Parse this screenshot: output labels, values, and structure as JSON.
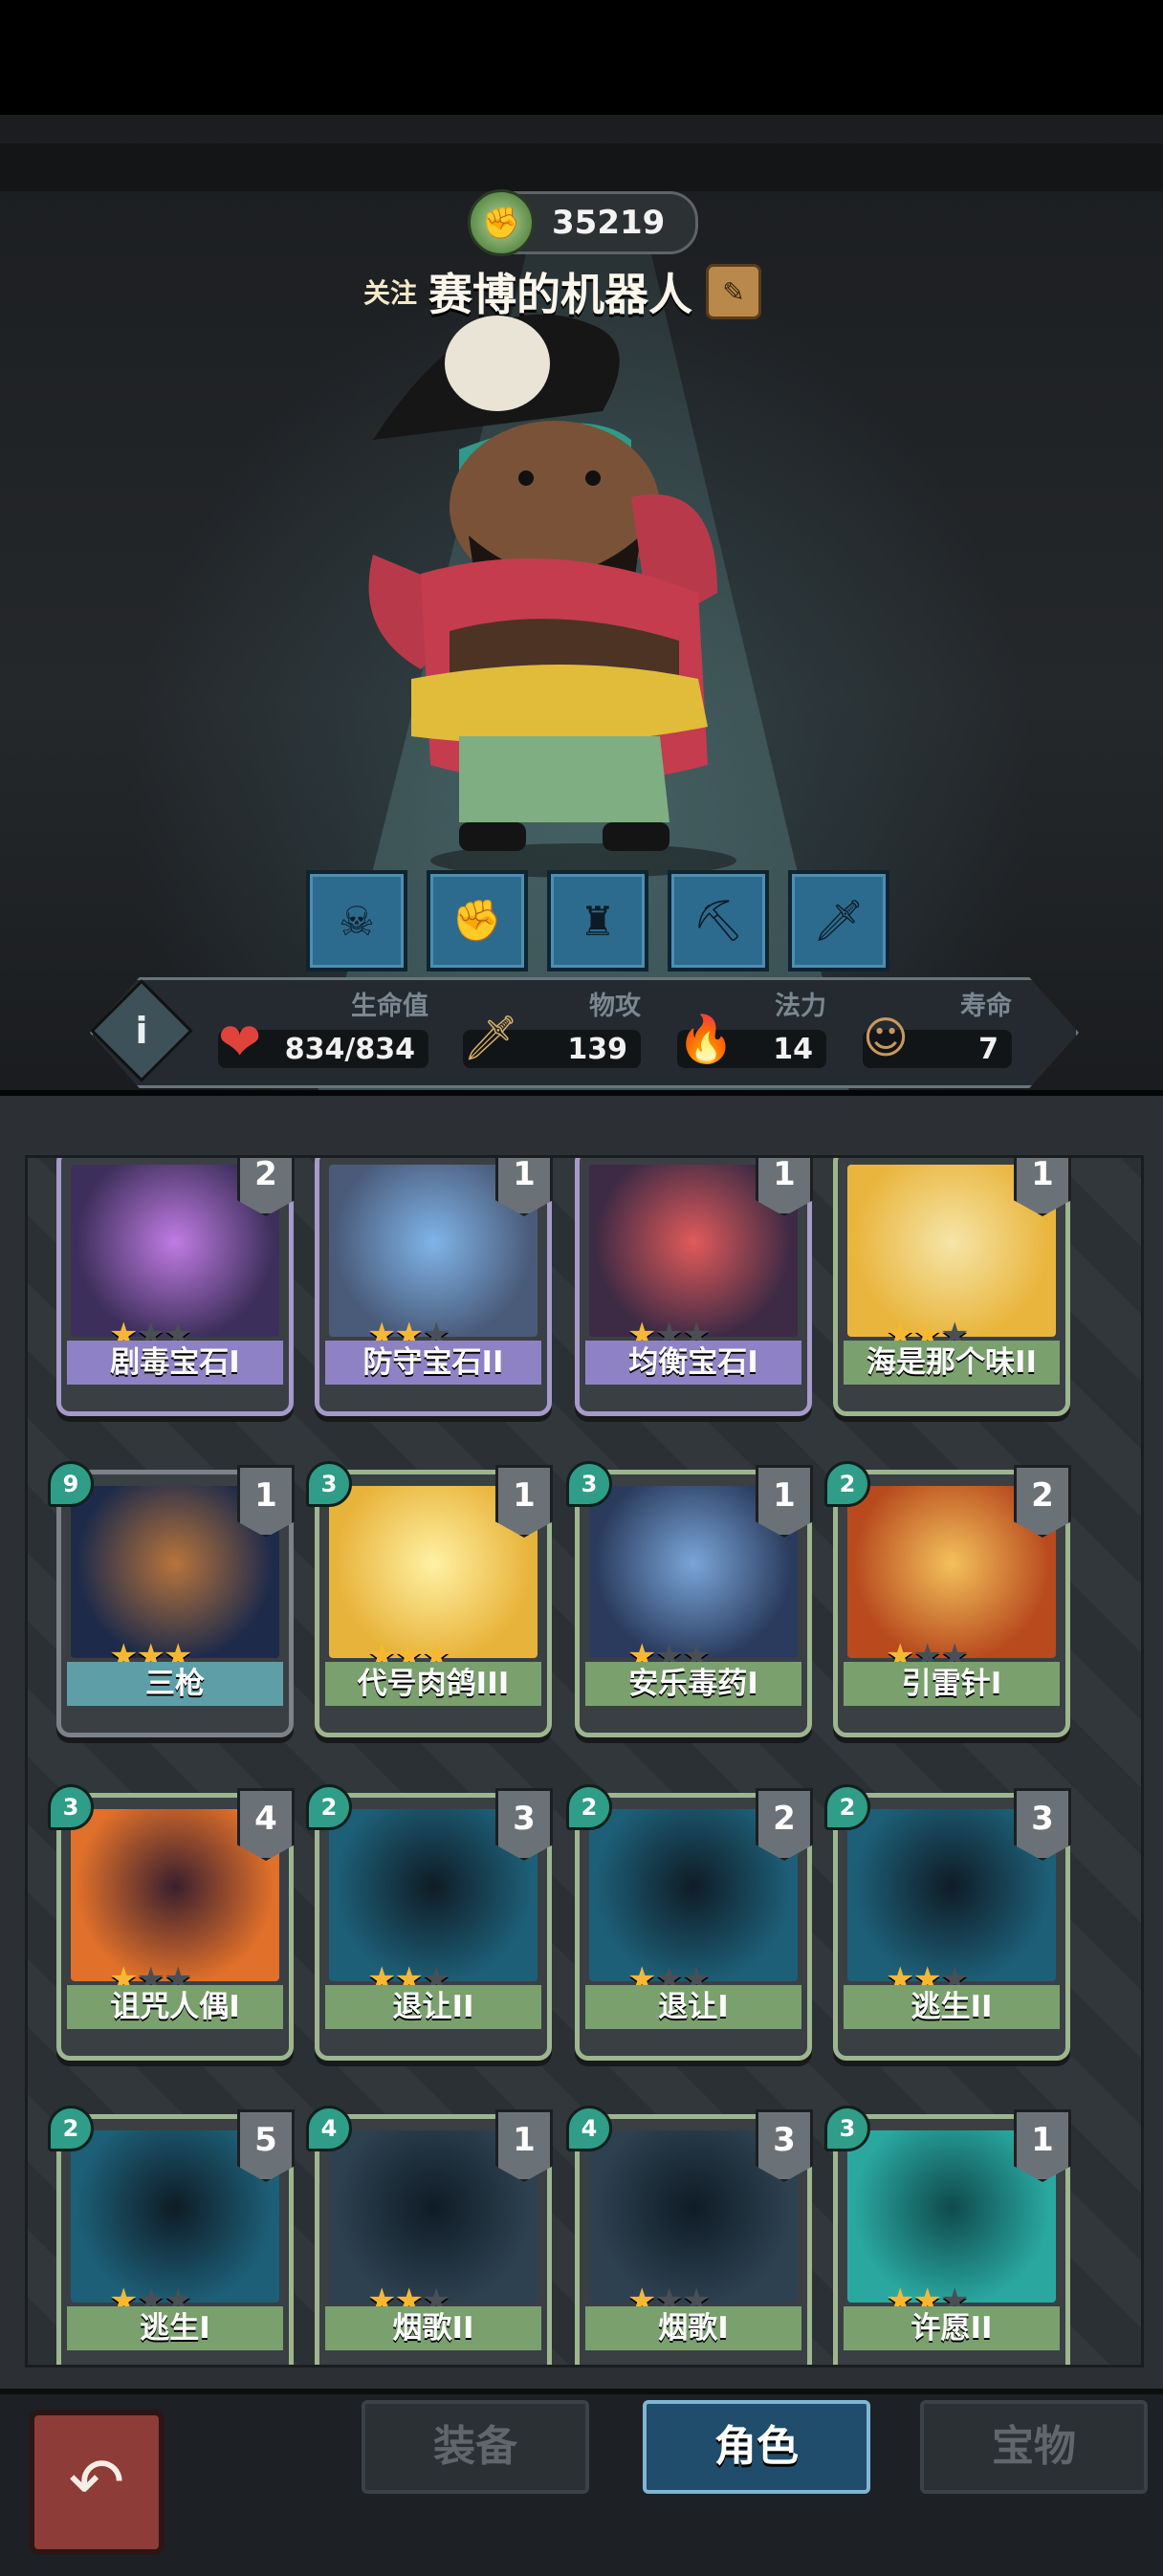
{
  "header": {
    "rating": "35219",
    "follow_label": "关注",
    "hero_name": "赛博的机器人"
  },
  "skills": [
    "bird-skull-icon",
    "fist-icon",
    "tower-icon",
    "pickaxe-icon",
    "dagger-icon"
  ],
  "stats": {
    "hp": {
      "label": "生命值",
      "value": "834/834"
    },
    "attack": {
      "label": "物攻",
      "value": "139"
    },
    "mana": {
      "label": "法力",
      "value": "14"
    },
    "lifespan": {
      "label": "寿命",
      "value": "7"
    }
  },
  "cards": [
    {
      "name": "剧毒宝石I",
      "stars": 1,
      "rarity": "rare",
      "cost": "",
      "count": "2"
    },
    {
      "name": "防守宝石II",
      "stars": 2,
      "rarity": "rare",
      "cost": "",
      "count": "1"
    },
    {
      "name": "均衡宝石I",
      "stars": 1,
      "rarity": "rare",
      "cost": "",
      "count": "1"
    },
    {
      "name": "海是那个味II",
      "stars": 2,
      "rarity": "uncommon",
      "cost": "",
      "count": "1"
    },
    {
      "name": "三枪",
      "stars": 3,
      "rarity": "gold",
      "cost": "9",
      "count": "1"
    },
    {
      "name": "代号肉鸽III",
      "stars": 3,
      "rarity": "uncommon",
      "cost": "3",
      "count": "1"
    },
    {
      "name": "安乐毒药I",
      "stars": 1,
      "rarity": "uncommon",
      "cost": "3",
      "count": "1"
    },
    {
      "name": "引雷针I",
      "stars": 1,
      "rarity": "uncommon",
      "cost": "2",
      "count": "2"
    },
    {
      "name": "诅咒人偶I",
      "stars": 1,
      "rarity": "uncommon",
      "cost": "3",
      "count": "4"
    },
    {
      "name": "退让II",
      "stars": 2,
      "rarity": "uncommon",
      "cost": "2",
      "count": "3"
    },
    {
      "name": "退让I",
      "stars": 1,
      "rarity": "uncommon",
      "cost": "2",
      "count": "2"
    },
    {
      "name": "逃生II",
      "stars": 2,
      "rarity": "uncommon",
      "cost": "2",
      "count": "3"
    },
    {
      "name": "逃生I",
      "stars": 1,
      "rarity": "uncommon",
      "cost": "2",
      "count": "5"
    },
    {
      "name": "烟歌II",
      "stars": 2,
      "rarity": "uncommon",
      "cost": "4",
      "count": "1"
    },
    {
      "name": "烟歌I",
      "stars": 1,
      "rarity": "uncommon",
      "cost": "4",
      "count": "3"
    },
    {
      "name": "许愿II",
      "stars": 2,
      "rarity": "uncommon",
      "cost": "3",
      "count": "1"
    }
  ],
  "tabs": {
    "equipment": "装备",
    "character": "角色",
    "treasure": "宝物"
  },
  "colors": {
    "accent": "#1f4d6b",
    "star": "#f6b833",
    "cost": "#2f9d88"
  }
}
